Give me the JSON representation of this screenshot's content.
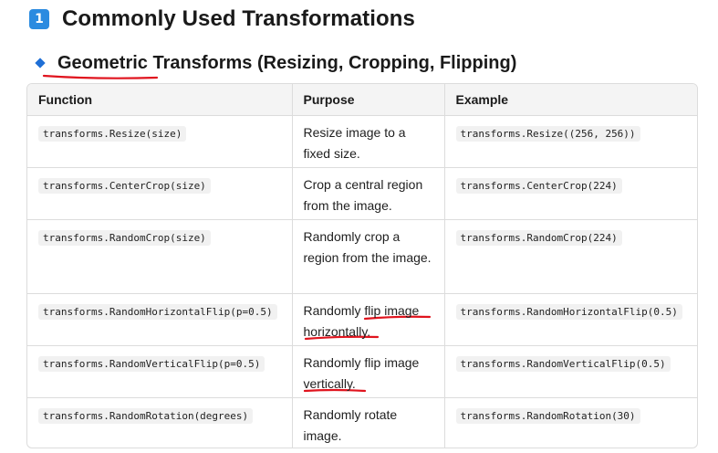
{
  "heading": {
    "badge": "1",
    "title": "Commonly Used Transformations"
  },
  "subheading": {
    "icon": "diamond-icon",
    "title": "Geometric Transforms (Resizing, Cropping, Flipping)"
  },
  "table": {
    "headers": [
      "Function",
      "Purpose",
      "Example"
    ],
    "rows": [
      {
        "function": "transforms.Resize(size)",
        "purpose": "Resize image to a fixed size.",
        "example": "transforms.Resize((256, 256))"
      },
      {
        "function": "transforms.CenterCrop(size)",
        "purpose": "Crop a central region from the image.",
        "example": "transforms.CenterCrop(224)"
      },
      {
        "function": "transforms.RandomCrop(size)",
        "purpose": "Randomly crop a region from the image.",
        "example": "transforms.RandomCrop(224)"
      },
      {
        "function": "transforms.RandomHorizontalFlip(p=0.5)",
        "purpose": "Randomly flip image horizontally.",
        "example": "transforms.RandomHorizontalFlip(0.5)"
      },
      {
        "function": "transforms.RandomVerticalFlip(p=0.5)",
        "purpose": "Randomly flip image vertically.",
        "example": "transforms.RandomVerticalFlip(0.5)"
      },
      {
        "function": "transforms.RandomRotation(degrees)",
        "purpose": "Randomly rotate image.",
        "example": "transforms.RandomRotation(30)"
      }
    ]
  },
  "colors": {
    "badge": "#2b8be0",
    "diamond": "#1f6fd6",
    "annotation": "#e0141e"
  }
}
